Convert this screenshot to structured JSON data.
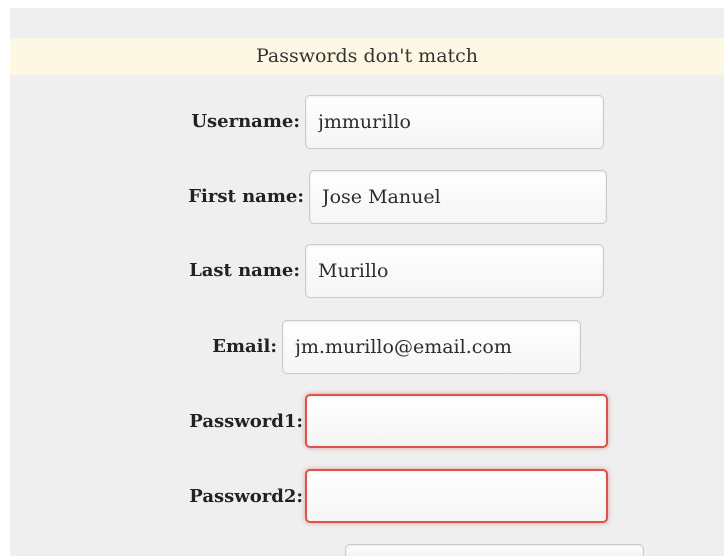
{
  "alert": {
    "message": "Passwords don't match"
  },
  "form": {
    "username": {
      "label": "Username:",
      "value": "jmmurillo"
    },
    "first_name": {
      "label": "First name:",
      "value": "Jose Manuel"
    },
    "last_name": {
      "label": "Last name:",
      "value": "Murillo"
    },
    "email": {
      "label": "Email:",
      "value": "jm.murillo@email.com"
    },
    "password1": {
      "label": "Password1:",
      "value": ""
    },
    "password2": {
      "label": "Password2:",
      "value": ""
    }
  },
  "colors": {
    "alert_background": "#fcf8e3",
    "page_background": "#efefef",
    "error_border": "#d9534f"
  }
}
